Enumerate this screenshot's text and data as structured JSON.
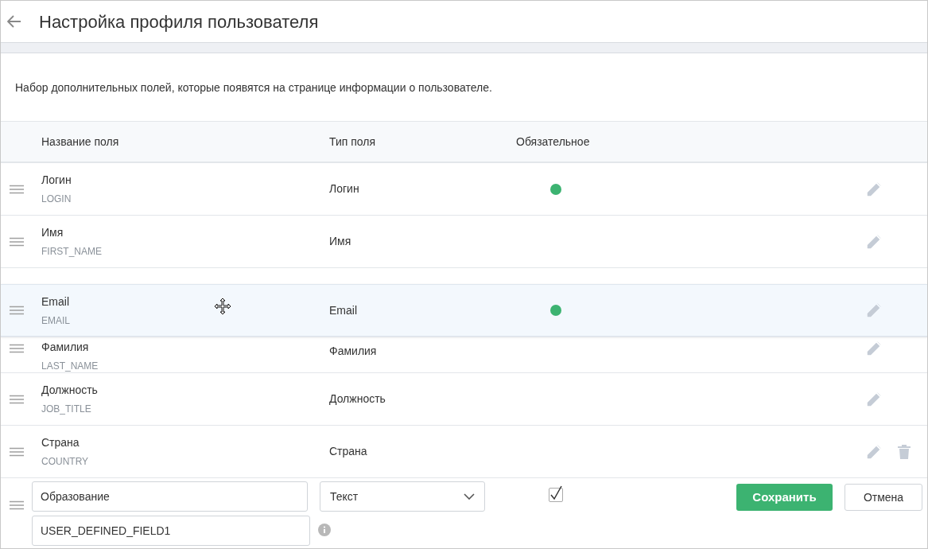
{
  "header": {
    "title": "Настройка профиля пользователя"
  },
  "description": "Набор дополнительных полей, которые появятся на странице информации о пользователе.",
  "columns": [
    "Название поля",
    "Тип поля",
    "Обязательное"
  ],
  "rows": [
    {
      "name": "Логин",
      "code": "LOGIN",
      "type": "Логин",
      "required": true,
      "dragging": false,
      "deletable": false
    },
    {
      "name": "Имя",
      "code": "FIRST_NAME",
      "type": "Имя",
      "required": false,
      "dragging": false,
      "deletable": false
    },
    {
      "name": "Email",
      "code": "EMAIL",
      "type": "Email",
      "required": true,
      "dragging": true,
      "deletable": false
    },
    {
      "name": "Фамилия",
      "code": "LAST_NAME",
      "type": "Фамилия",
      "required": false,
      "dragging": false,
      "deletable": false
    },
    {
      "name": "Должность",
      "code": "JOB_TITLE",
      "type": "Должность",
      "required": false,
      "dragging": false,
      "deletable": false
    },
    {
      "name": "Страна",
      "code": "COUNTRY",
      "type": "Страна",
      "required": false,
      "dragging": false,
      "deletable": true
    }
  ],
  "edit_row": {
    "name": "Образование",
    "code": "USER_DEFINED_FIELD1",
    "type": "Текст",
    "required": true,
    "save": "Сохранить",
    "cancel": "Отмена"
  }
}
